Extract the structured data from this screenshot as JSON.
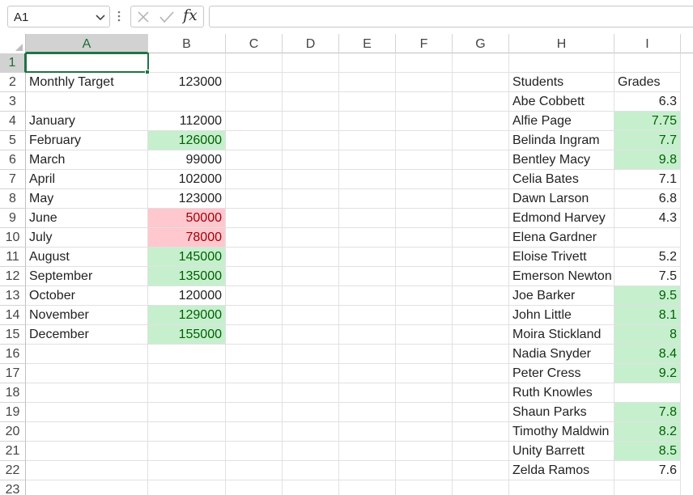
{
  "namebox": {
    "value": "A1",
    "chevron_icon": "chevron-down-icon"
  },
  "formula_bar": {
    "more_icon": "vertical-dots-icon",
    "cancel_icon": "close-icon",
    "enter_icon": "check-icon",
    "fx_label": "fx",
    "value": ""
  },
  "columns": [
    "A",
    "B",
    "C",
    "D",
    "E",
    "F",
    "G",
    "H",
    "I"
  ],
  "rows": [
    "1",
    "2",
    "3",
    "4",
    "5",
    "6",
    "7",
    "8",
    "9",
    "10",
    "11",
    "12",
    "13",
    "14",
    "15",
    "16",
    "17",
    "18",
    "19",
    "20",
    "21",
    "22",
    "23"
  ],
  "cells": {
    "A2": "Monthly Target",
    "B2": "123000",
    "A4": "January",
    "B4": "112000",
    "A5": "February",
    "B5": "126000",
    "A6": "March",
    "B6": "99000",
    "A7": "April",
    "B7": "102000",
    "A8": "May",
    "B8": "123000",
    "A9": "June",
    "B9": "50000",
    "A10": "July",
    "B10": "78000",
    "A11": "August",
    "B11": "145000",
    "A12": "September",
    "B12": "135000",
    "A13": "October",
    "B13": "120000",
    "A14": "November",
    "B14": "129000",
    "A15": "December",
    "B15": "155000",
    "H2": "Students",
    "I2": "Grades",
    "H3": "Abe Cobbett",
    "I3": "6.3",
    "H4": "Alfie Page",
    "I4": "7.75",
    "H5": "Belinda Ingram",
    "I5": "7.7",
    "H6": "Bentley Macy",
    "I6": "9.8",
    "H7": "Celia Bates",
    "I7": "7.1",
    "H8": "Dawn Larson",
    "I8": "6.8",
    "H9": "Edmond Harvey",
    "I9": "4.3",
    "H10": "Elena Gardner",
    "H11": "Eloise Trivett",
    "I11": "5.2",
    "H12": "Emerson Newton",
    "I12": "7.5",
    "H13": "Joe Barker",
    "I13": "9.5",
    "H14": "John Little",
    "I14": "8.1",
    "H15": "Moira Stickland",
    "I15": "8",
    "H16": "Nadia Snyder",
    "I16": "8.4",
    "H17": "Peter Cress",
    "I17": "9.2",
    "H18": "Ruth Knowles",
    "H19": "Shaun Parks",
    "I19": "7.8",
    "H20": "Timothy Maldwin",
    "I20": "8.2",
    "H21": "Unity Barrett",
    "I21": "8.5",
    "H22": "Zelda Ramos",
    "I22": "7.6"
  },
  "highlight_colors": {
    "green_fill": "#c6efce",
    "green_text": "#006100",
    "red_fill": "#ffc7ce",
    "red_text": "#9c0006",
    "selection": "#217346"
  },
  "green_cells": [
    "B5",
    "B11",
    "B12",
    "B14",
    "B15",
    "I4",
    "I5",
    "I6",
    "I13",
    "I14",
    "I15",
    "I16",
    "I17",
    "I19",
    "I20",
    "I21"
  ],
  "red_cells": [
    "B9",
    "B10"
  ],
  "selected_cell": "A1"
}
